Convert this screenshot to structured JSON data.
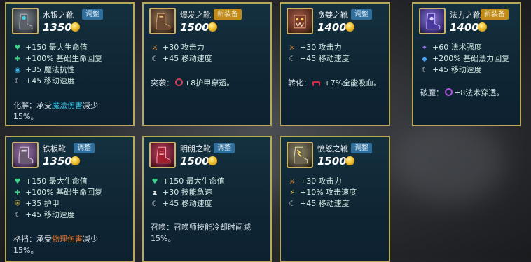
{
  "cards": [
    {
      "name": "水银之靴",
      "badge": "调整",
      "badge_type": "adjust",
      "price": "1350",
      "icon": "mercury-boots-icon",
      "stats": [
        {
          "icon": "heart-icon",
          "symbol": "♥",
          "color": "#3fd28a",
          "text": "+150 最大生命值"
        },
        {
          "icon": "health-regen-icon",
          "symbol": "✚",
          "color": "#3fd28a",
          "text": "+100% 基础生命回复"
        },
        {
          "icon": "magic-resist-icon",
          "symbol": "◉",
          "color": "#3fb8e8",
          "text": "+35 魔法抗性"
        },
        {
          "icon": "move-speed-icon",
          "symbol": "☾",
          "color": "#e6e6e6",
          "text": "+45 移动速度"
        }
      ],
      "passive": {
        "prefix": "化解：承受",
        "highlight": "魔法伤害",
        "suffix": "减少",
        "line2": "15%。",
        "hl": "magic"
      }
    },
    {
      "name": "爆发之靴",
      "badge": "新装备",
      "badge_type": "newitem",
      "price": "1500",
      "icon": "burst-boots-icon",
      "stats": [
        {
          "icon": "attack-damage-icon",
          "symbol": "⚔",
          "color": "#f09030",
          "text": "+30 攻击力"
        },
        {
          "icon": "move-speed-icon",
          "symbol": "☾",
          "color": "#e6e6e6",
          "text": "+45 移动速度"
        }
      ],
      "passive": {
        "prefix": "突袭：",
        "icon": "armor-pen-icon",
        "iconcolor": "#d0405a",
        "value": "+8护甲穿透。"
      }
    },
    {
      "name": "贪婪之靴",
      "badge": "调整",
      "badge_type": "adjust",
      "price": "1400",
      "icon": "greed-boots-icon",
      "stats": [
        {
          "icon": "attack-damage-icon",
          "symbol": "⚔",
          "color": "#f09030",
          "text": "+30 攻击力"
        },
        {
          "icon": "move-speed-icon",
          "symbol": "☾",
          "color": "#e6e6e6",
          "text": "+45 移动速度"
        }
      ],
      "passive": {
        "prefix": "转化：",
        "icon": "omnivamp-icon",
        "iconcolor": "#d03040",
        "value": "+7%全能吸血。"
      }
    },
    {
      "name": "法力之靴",
      "badge": "新装备",
      "badge_type": "newitem",
      "price": "1400",
      "icon": "mana-boots-icon",
      "stats": [
        {
          "icon": "ability-power-icon",
          "symbol": "✦",
          "color": "#a070f0",
          "text": "+60 法术强度"
        },
        {
          "icon": "mana-regen-icon",
          "symbol": "◆",
          "color": "#4aa0f0",
          "text": "+200% 基础法力回复"
        },
        {
          "icon": "move-speed-icon",
          "symbol": "☾",
          "color": "#e6e6e6",
          "text": "+45 移动速度"
        }
      ],
      "passive": {
        "prefix": "破魔：",
        "icon": "magic-pen-icon",
        "iconcolor": "#b050e0",
        "value": "+8法术穿透。"
      }
    },
    {
      "name": "铁板靴",
      "badge": "调整",
      "badge_type": "adjust",
      "price": "1350",
      "icon": "plated-boots-icon",
      "stats": [
        {
          "icon": "heart-icon",
          "symbol": "♥",
          "color": "#3fd28a",
          "text": "+150 最大生命值"
        },
        {
          "icon": "health-regen-icon",
          "symbol": "✚",
          "color": "#3fd28a",
          "text": "+100% 基础生命回复"
        },
        {
          "icon": "armor-icon",
          "symbol": "⛨",
          "color": "#e8c030",
          "text": "+35 护甲"
        },
        {
          "icon": "move-speed-icon",
          "symbol": "☾",
          "color": "#e6e6e6",
          "text": "+45 移动速度"
        }
      ],
      "passive": {
        "prefix": "格挡：承受",
        "highlight": "物理伤害",
        "suffix": "减少",
        "line2": "15%。",
        "hl": "phys"
      }
    },
    {
      "name": "明朗之靴",
      "badge": "调整",
      "badge_type": "adjust",
      "price": "1500",
      "icon": "lucidity-boots-icon",
      "stats": [
        {
          "icon": "heart-icon",
          "symbol": "♥",
          "color": "#3fd28a",
          "text": "+150 最大生命值"
        },
        {
          "icon": "ability-haste-icon",
          "symbol": "⧗",
          "color": "#e6e6e6",
          "text": "+30 技能急速"
        },
        {
          "icon": "move-speed-icon",
          "symbol": "☾",
          "color": "#e6e6e6",
          "text": "+45 移动速度"
        }
      ],
      "passive": {
        "prefix": "召唤：召唤师技能冷却时间减",
        "line2": "15%。",
        "hl": "none"
      }
    },
    {
      "name": "愤怒之靴",
      "badge": "调整",
      "badge_type": "adjust",
      "price": "1500",
      "icon": "fury-boots-icon",
      "stats": [
        {
          "icon": "attack-damage-icon",
          "symbol": "⚔",
          "color": "#f09030",
          "text": "+30 攻击力"
        },
        {
          "icon": "attack-speed-icon",
          "symbol": "⚡",
          "color": "#f0c030",
          "text": "+10% 攻击速度"
        },
        {
          "icon": "move-speed-icon",
          "symbol": "☾",
          "color": "#e6e6e6",
          "text": "+45 移动速度"
        }
      ]
    }
  ]
}
